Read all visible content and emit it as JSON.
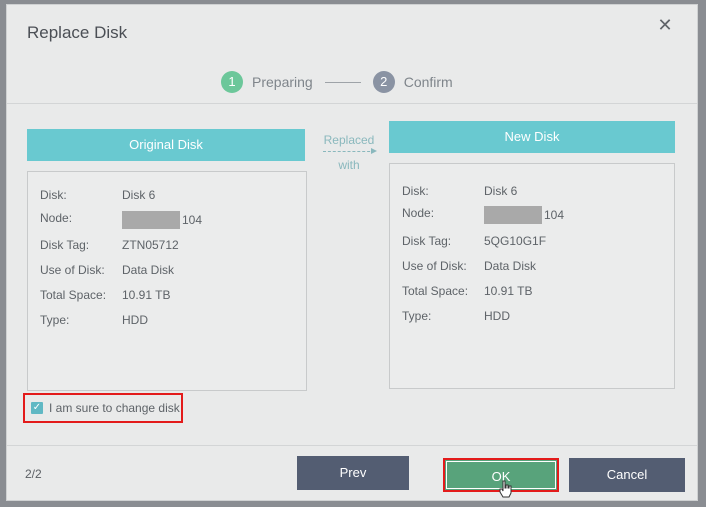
{
  "dialog": {
    "title": "Replace Disk",
    "close_icon": "close-icon"
  },
  "steps": [
    {
      "number": "1",
      "label": "Preparing",
      "state": "active"
    },
    {
      "number": "2",
      "label": "Confirm",
      "state": "inactive"
    }
  ],
  "original_disk": {
    "header": "Original Disk",
    "rows": [
      {
        "label": "Disk:",
        "value": "Disk 6"
      },
      {
        "label": "Node:",
        "value": "104",
        "redacted_prefix": true
      },
      {
        "label": "Disk Tag:",
        "value": "ZTN05712"
      },
      {
        "label": "Use of Disk:",
        "value": "Data Disk"
      },
      {
        "label": "Total Space:",
        "value": "10.91 TB"
      },
      {
        "label": "Type:",
        "value": "HDD"
      }
    ]
  },
  "replaced_with": {
    "line1": "Replaced",
    "line2": "with"
  },
  "new_disk": {
    "header": "New Disk",
    "rows": [
      {
        "label": "Disk:",
        "value": "Disk 6"
      },
      {
        "label": "Node:",
        "value": "104",
        "redacted_prefix": true
      },
      {
        "label": "Disk Tag:",
        "value": "5QG10G1F"
      },
      {
        "label": "Use of Disk:",
        "value": "Data Disk"
      },
      {
        "label": "Total Space:",
        "value": "10.91 TB"
      },
      {
        "label": "Type:",
        "value": "HDD"
      }
    ]
  },
  "confirm_checkbox": {
    "label": "I am sure to change disk",
    "checked": true
  },
  "footer": {
    "page_indicator": "2/2",
    "prev_label": "Prev",
    "ok_label": "OK",
    "cancel_label": "Cancel"
  },
  "colors": {
    "header_teal": "#69c9d0",
    "ok_green": "#58a37b",
    "button_slate": "#535d72",
    "highlight_red": "#e31b1b"
  }
}
